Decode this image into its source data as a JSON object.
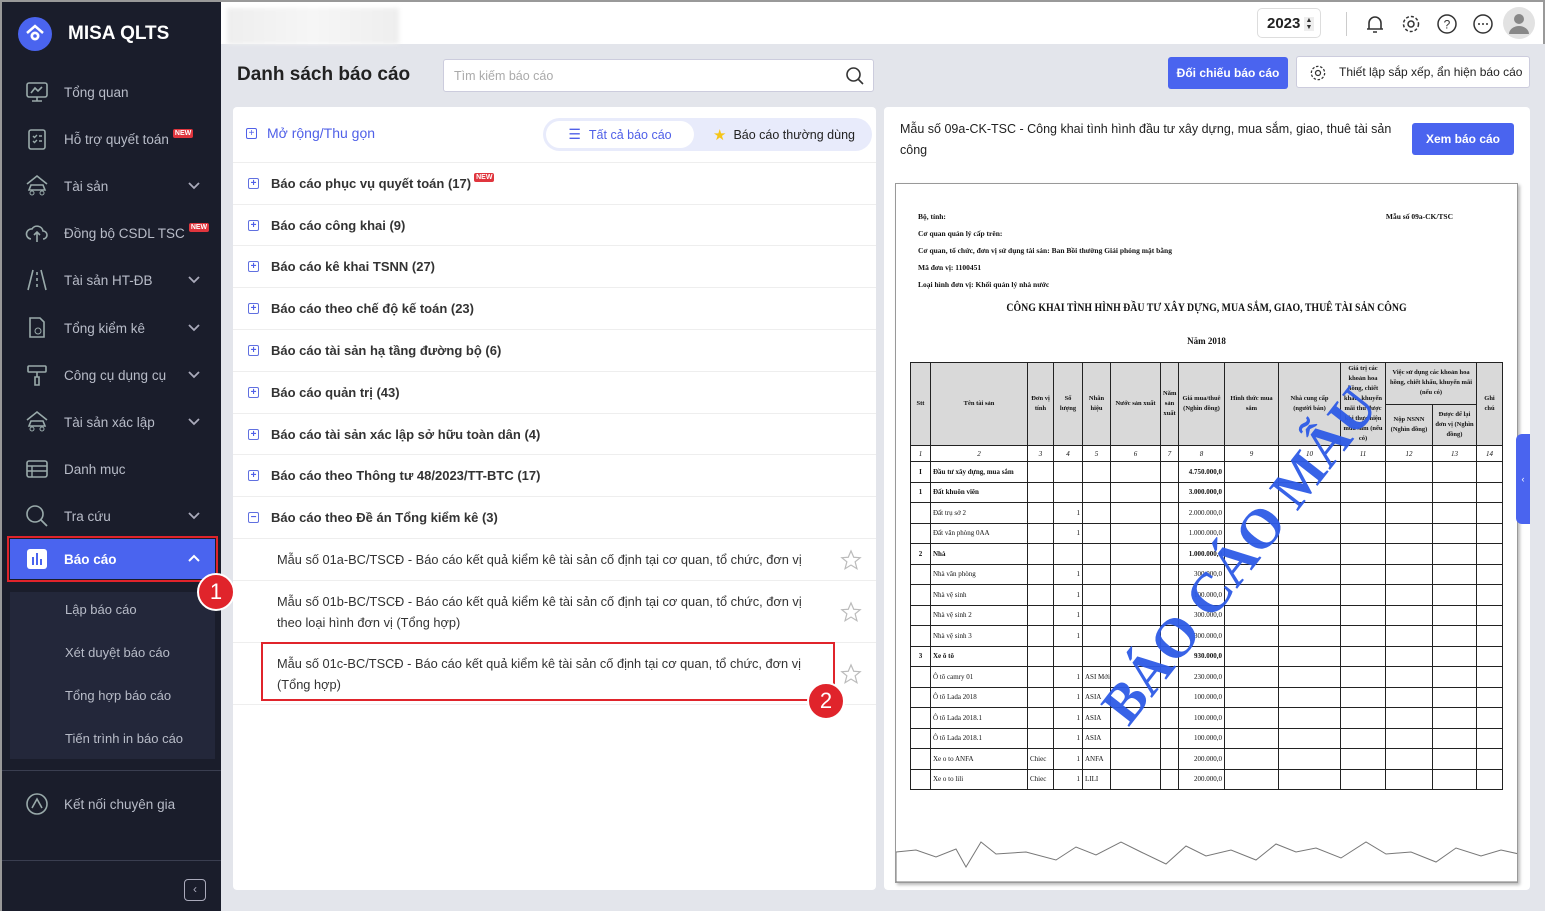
{
  "app": {
    "name": "MISA QLTS"
  },
  "sidebar": {
    "items": [
      {
        "label": "Tổng quan",
        "icon": "monitor-chart-icon"
      },
      {
        "label": "Hỗ trợ quyết toán",
        "icon": "clipboard-check-icon",
        "badge": "NEW"
      },
      {
        "label": "Tài sản",
        "icon": "house-car-icon",
        "expand": true
      },
      {
        "label": "Đồng bộ CSDL TSC",
        "icon": "cloud-upload-icon",
        "badge": "NEW"
      },
      {
        "label": "Tài sản HT-ĐB",
        "icon": "road-icon",
        "expand": true
      },
      {
        "label": "Tổng kiểm kê",
        "icon": "document-search-icon",
        "expand": true
      },
      {
        "label": "Công cụ dụng cụ",
        "icon": "tools-icon",
        "expand": true
      },
      {
        "label": "Tài sản xác lập",
        "icon": "house-car-icon",
        "expand": true
      },
      {
        "label": "Danh mục",
        "icon": "list-icon"
      },
      {
        "label": "Tra cứu",
        "icon": "search-icon",
        "expand": true
      }
    ],
    "active": {
      "label": "Báo cáo",
      "icon": "bar-chart-icon"
    },
    "submenu": [
      "Lập báo cáo",
      "Xét duyệt báo cáo",
      "Tổng hợp báo cáo",
      "Tiến trình in báo cáo"
    ],
    "footer": "Kết nối chuyên gia"
  },
  "annotations": {
    "one": "1",
    "two": "2"
  },
  "topbar": {
    "year": "2023"
  },
  "header": {
    "title": "Danh sách báo cáo",
    "search_placeholder": "Tìm kiếm báo cáo",
    "compare_button": "Đối chiếu báo cáo",
    "settings_button": "Thiết lập sắp xếp, ẩn hiện báo cáo"
  },
  "list": {
    "expand_label": "Mở rộng/Thu gọn",
    "tab_all": "Tất cả báo cáo",
    "tab_favorite": "Báo cáo thường dùng",
    "groups": [
      {
        "label": "Báo cáo phục vụ quyết toán (17)",
        "badge": "NEW"
      },
      {
        "label": "Báo cáo công khai (9)"
      },
      {
        "label": "Báo cáo kê khai TSNN (27)"
      },
      {
        "label": "Báo cáo theo chế độ kế toán (23)"
      },
      {
        "label": "Báo cáo tài sản hạ tầng đường bộ (6)"
      },
      {
        "label": "Báo cáo quản trị (43)"
      },
      {
        "label": "Báo cáo tài sản xác lập sở hữu toàn dân (4)"
      },
      {
        "label": "Báo cáo theo Thông tư 48/2023/TT-BTC (17)"
      },
      {
        "label": "Báo cáo theo Đề án Tổng kiểm kê (3)",
        "expanded": true
      }
    ],
    "children": [
      "Mẫu số 01a-BC/TSCĐ - Báo cáo kết quả kiểm kê tài sản cố định tại cơ quan, tổ chức, đơn vị",
      "Mẫu số 01b-BC/TSCĐ - Báo cáo kết quả kiểm kê tài sản cố định tại cơ quan, tổ chức, đơn vị theo loại hình đơn vị (Tổng hợp)",
      "Mẫu số 01c-BC/TSCĐ - Báo cáo kết quả kiểm kê tài sản cố định tại cơ quan, tổ chức, đơn vị (Tổng hợp)"
    ]
  },
  "preview": {
    "title": "Mẫu số 09a-CK-TSC - Công khai tình hình đầu tư xây dựng, mua sắm, giao, thuê tài sản công",
    "view_button": "Xem báo cáo",
    "doc": {
      "meta": [
        "Bộ, tỉnh:",
        "Cơ quan quản lý cấp trên:",
        "Cơ quan, tổ chức, đơn vị sử dụng tài sản: Ban Bồi thường Giải phóng mặt bằng",
        "Mã đơn vị: 1100451",
        "Loại hình đơn vị: Khối quản lý nhà nước"
      ],
      "form_no": "Mẫu số 09a-CK/TSC",
      "title": "CÔNG KHAI TÌNH HÌNH ĐẦU TƯ XÂY DỰNG, MUA SẮM, GIAO, THUÊ TÀI SẢN CÔNG",
      "year": "Năm 2018",
      "watermark": "BÁO CÁO MẪU",
      "headers": [
        "Stt",
        "Tên tài sản",
        "Đơn vị tính",
        "Số lượng",
        "Nhãn hiệu",
        "Nước sản xuất",
        "Năm sản xuất",
        "Giá mua/thuê (Nghìn đồng)",
        "Hình thức mua sắm",
        "Nhà cung cấp (người bán)",
        "Giá trị các khoản hoa hồng, chiết khấu, khuyến mãi thu được khi thực hiện mua sắm (nếu có)",
        "Nộp NSNN (Nghìn đồng)",
        "Được để lại đơn vị (Nghìn đồng)",
        "Ghi chú"
      ],
      "group_header": "Việc sử dụng các khoản hoa hồng, chiết khấu, khuyến mãi (nếu có)",
      "col_numbers": [
        "1",
        "2",
        "3",
        "4",
        "5",
        "6",
        "7",
        "8",
        "9",
        "10",
        "11",
        "12",
        "13",
        "14"
      ],
      "rows": [
        {
          "stt": "I",
          "name": "Đầu tư xây dựng, mua sắm",
          "unit": "",
          "qty": "",
          "brand": "",
          "price": "4.750.000,0",
          "bold": true
        },
        {
          "stt": "1",
          "name": "Đất khuôn viên",
          "unit": "",
          "qty": "",
          "brand": "",
          "price": "3.000.000,0",
          "bold": true
        },
        {
          "stt": "",
          "name": "Đất trụ sở 2",
          "unit": "",
          "qty": "1",
          "brand": "",
          "price": "2.000.000,0"
        },
        {
          "stt": "",
          "name": "Đất văn phòng 0AA",
          "unit": "",
          "qty": "1",
          "brand": "",
          "price": "1.000.000,0"
        },
        {
          "stt": "2",
          "name": "Nhà",
          "unit": "",
          "qty": "",
          "brand": "",
          "price": "1.000.000,0",
          "bold": true
        },
        {
          "stt": "",
          "name": "Nhà văn phòng",
          "unit": "",
          "qty": "1",
          "brand": "",
          "price": "300.000,0"
        },
        {
          "stt": "",
          "name": "Nhà vệ sinh",
          "unit": "",
          "qty": "1",
          "brand": "",
          "price": "100.000,0"
        },
        {
          "stt": "",
          "name": "Nhà vệ sinh 2",
          "unit": "",
          "qty": "1",
          "brand": "",
          "price": "300.000,0"
        },
        {
          "stt": "",
          "name": "Nhà vệ sinh 3",
          "unit": "",
          "qty": "1",
          "brand": "",
          "price": "300.000,0"
        },
        {
          "stt": "3",
          "name": "Xe ô tô",
          "unit": "",
          "qty": "",
          "brand": "",
          "price": "930.000,0",
          "bold": true
        },
        {
          "stt": "",
          "name": "Ô tô camry 01",
          "unit": "",
          "qty": "1",
          "brand": "ASI Mới",
          "price": "230.000,0"
        },
        {
          "stt": "",
          "name": "Ô tô Lada 2018",
          "unit": "",
          "qty": "1",
          "brand": "ASIA",
          "price": "100.000,0"
        },
        {
          "stt": "",
          "name": "Ô tô Lada 2018.1",
          "unit": "",
          "qty": "1",
          "brand": "ASIA",
          "price": "100.000,0"
        },
        {
          "stt": "",
          "name": "Ô tô Lada 2018.1",
          "unit": "",
          "qty": "1",
          "brand": "ASIA",
          "price": "100.000,0"
        },
        {
          "stt": "",
          "name": "Xe o to ANFA",
          "unit": "Chiec",
          "qty": "1",
          "brand": "ANFA",
          "price": "200.000,0"
        },
        {
          "stt": "",
          "name": "Xe o to lili",
          "unit": "Chiec",
          "qty": "1",
          "brand": "LILI",
          "price": "200.000,0"
        }
      ]
    }
  },
  "colors": {
    "accent": "#4a64ef",
    "sidebar": "#1a1d2b",
    "highlight": "#e0242b"
  }
}
